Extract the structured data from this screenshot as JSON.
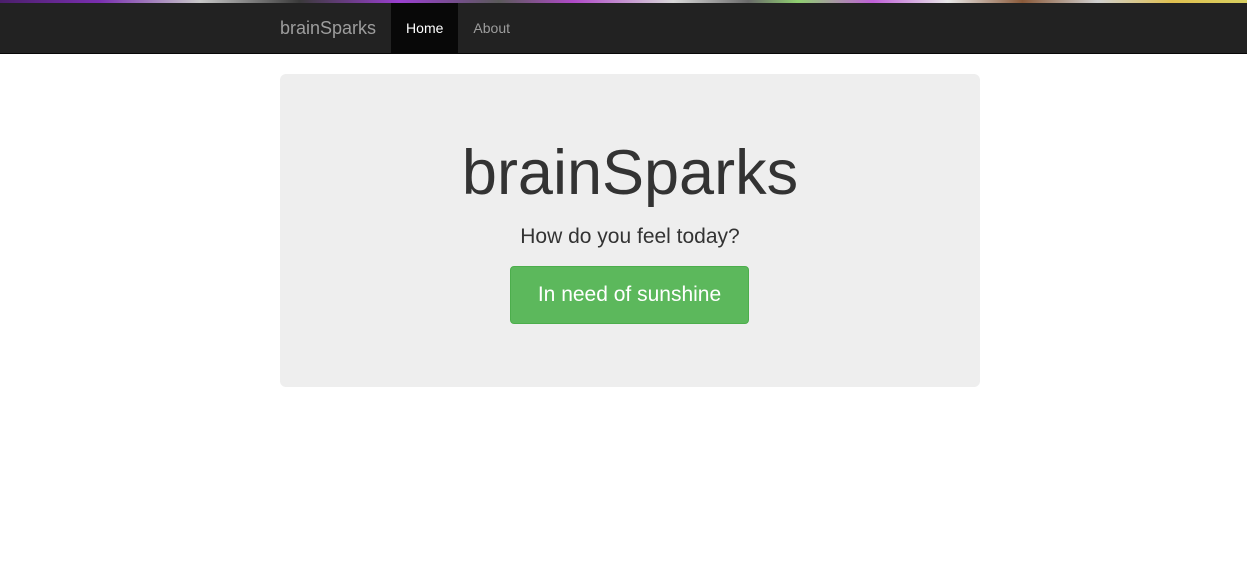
{
  "navbar": {
    "brand": "brainSparks",
    "items": [
      {
        "label": "Home",
        "active": true
      },
      {
        "label": "About",
        "active": false
      }
    ]
  },
  "hero": {
    "title": "brainSparks",
    "subtitle": "How do you feel today?",
    "button_label": "In need of sunshine"
  },
  "colors": {
    "navbar_bg": "#222222",
    "active_nav_bg": "#080808",
    "hero_bg": "#eeeeee",
    "button_bg": "#5cb85c"
  }
}
